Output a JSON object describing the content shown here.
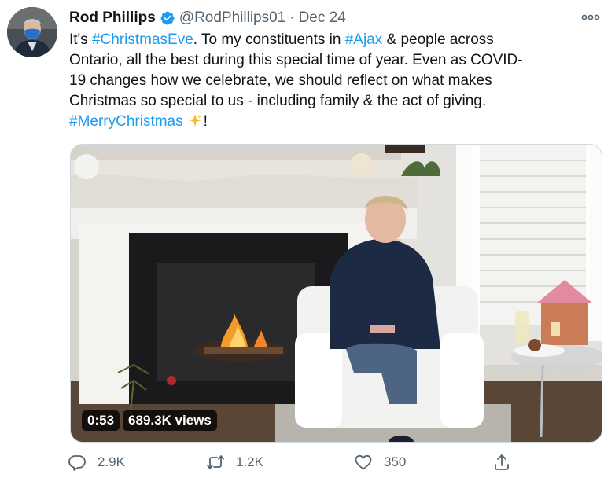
{
  "author": {
    "display_name": "Rod Phillips",
    "handle": "@RodPhillips01",
    "separator": "·",
    "date": "Dec 24",
    "verified": true
  },
  "tweet": {
    "lines": [
      [
        {
          "text": "It's ",
          "tag": false
        },
        {
          "text": "#ChristmasEve",
          "tag": true
        },
        {
          "text": ". To my constituents in ",
          "tag": false
        },
        {
          "text": "#Ajax",
          "tag": true
        },
        {
          "text": " & people across",
          "tag": false
        }
      ],
      [
        {
          "text": "Ontario, all the best during this special time of year. Even as COVID-",
          "tag": false
        }
      ],
      [
        {
          "text": "19 changes how we celebrate, we should reflect on what makes",
          "tag": false
        }
      ],
      [
        {
          "text": "Christmas so special to us - including family & the act of giving.",
          "tag": false
        }
      ]
    ],
    "last_line_hashtag": "#MerryChristmas",
    "last_line_emoji": "sparkles-emoji",
    "last_line_suffix": "!"
  },
  "video": {
    "duration": "0:53",
    "views": "689.3K views"
  },
  "stats": {
    "replies": "2.9K",
    "retweets": "1.2K",
    "likes": "350"
  },
  "icons": {
    "reply": "reply-icon",
    "retweet": "retweet-icon",
    "like": "heart-icon",
    "share": "share-icon",
    "more": "more-icon",
    "verified": "verified-badge-icon"
  },
  "colors": {
    "accent": "#1d9bf0",
    "secondary_text": "#536471",
    "primary_text": "#0f1419"
  }
}
